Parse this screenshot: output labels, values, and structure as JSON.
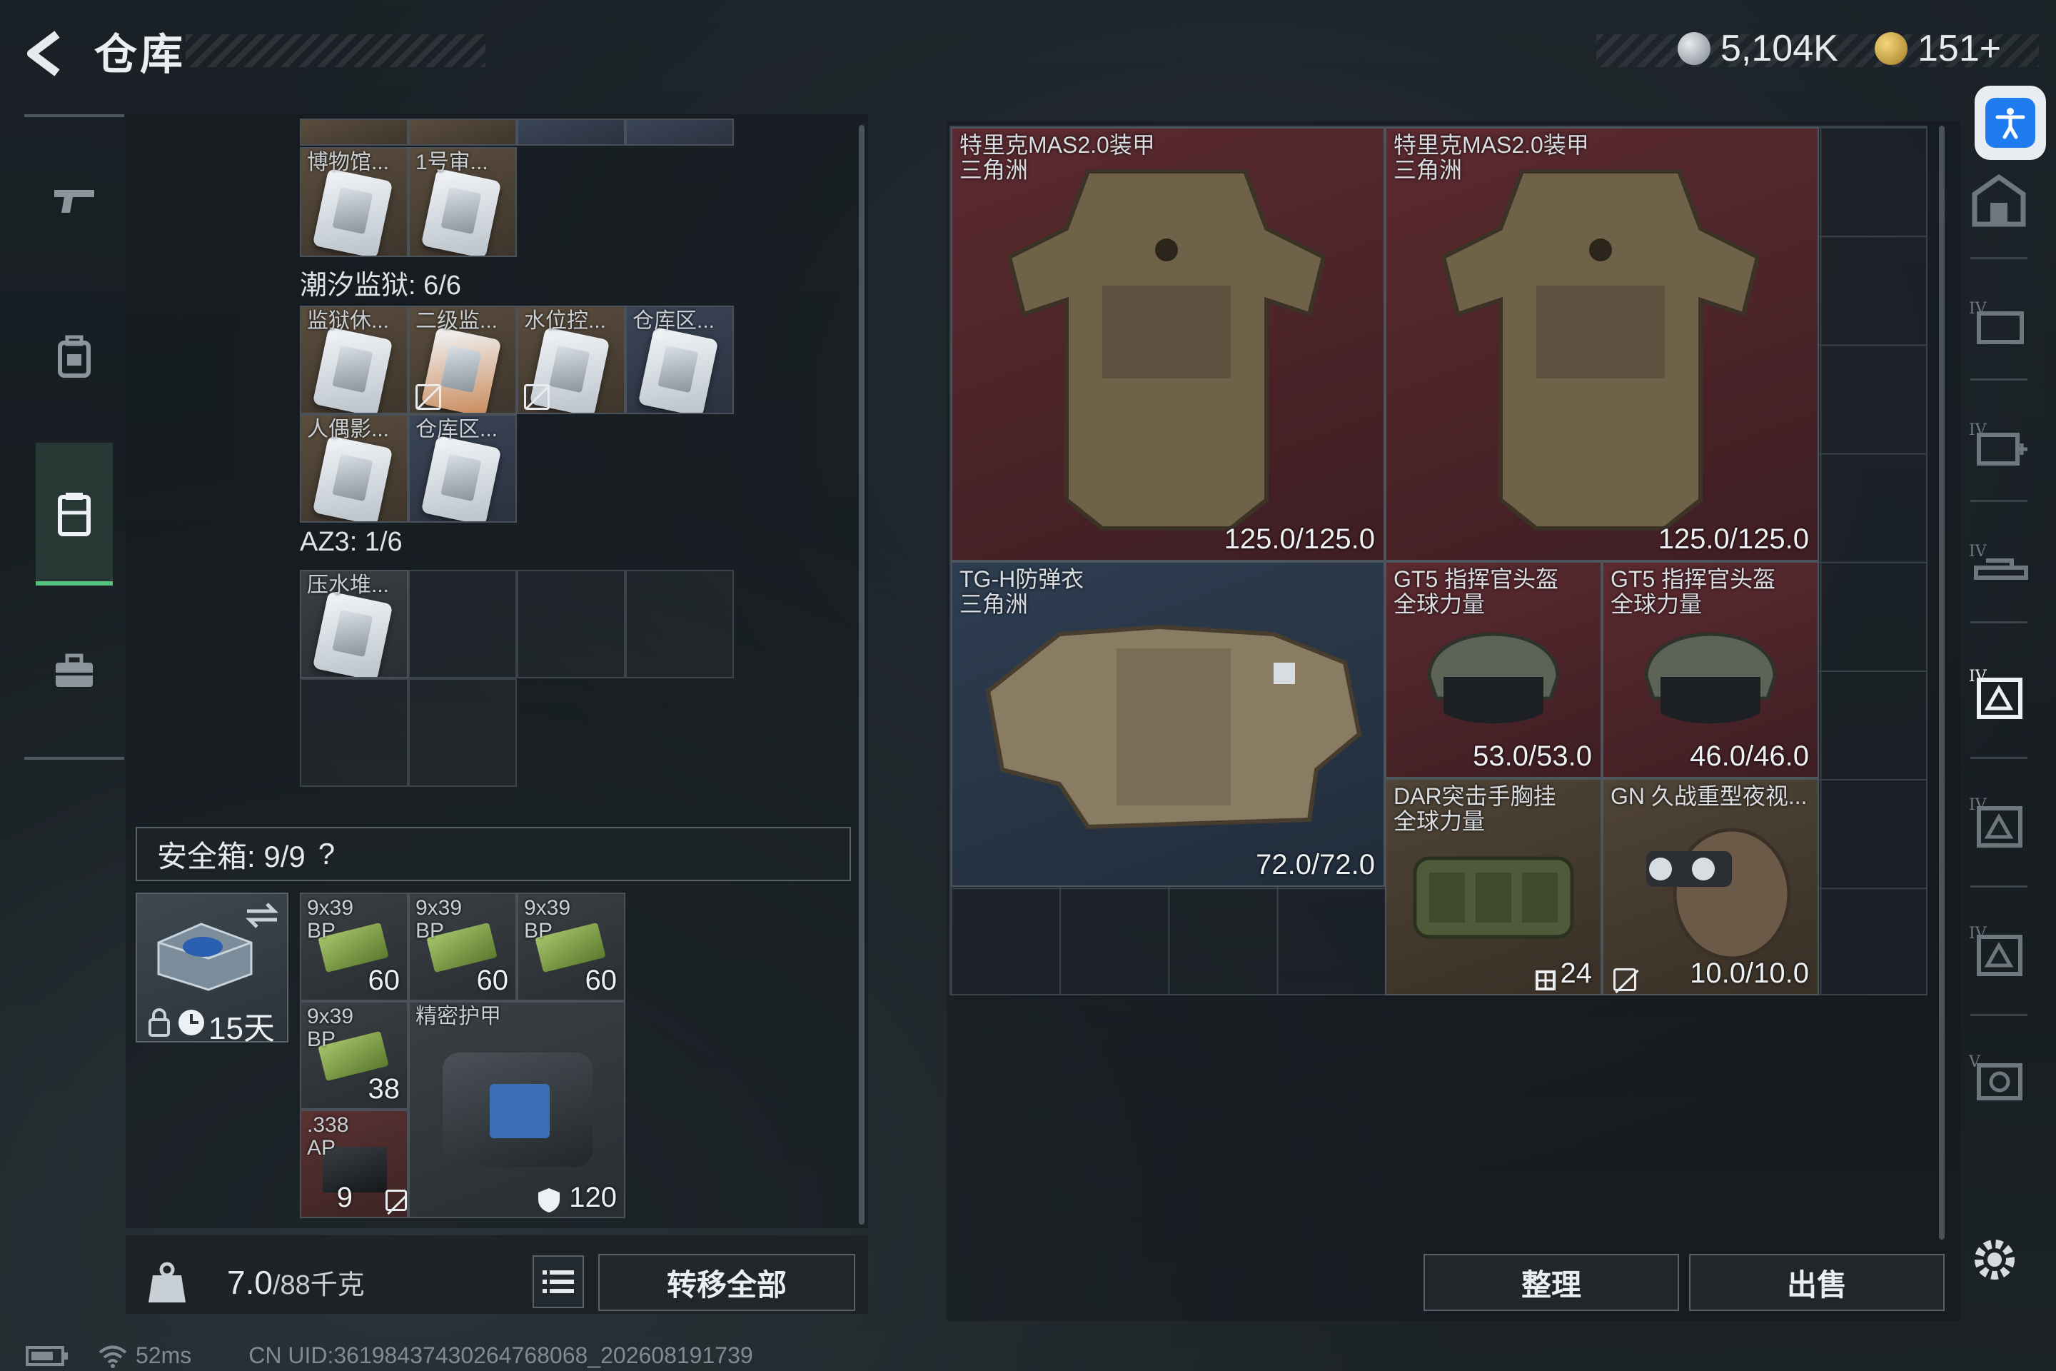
{
  "header": {
    "title": "仓库"
  },
  "currency": {
    "silver": "5,104K",
    "gold": "151+"
  },
  "left": {
    "top_partial_items": [
      {
        "label": "博物馆..."
      },
      {
        "label": "1号审..."
      }
    ],
    "sections": [
      {
        "name": "潮汐监狱: 6/6",
        "items": [
          {
            "label": "监狱休..."
          },
          {
            "label": "二级监..."
          },
          {
            "label": "水位控..."
          },
          {
            "label": "仓库区..."
          },
          {
            "label": "人偶影..."
          },
          {
            "label": "仓库区..."
          }
        ]
      },
      {
        "name": "AZ3: 1/6",
        "items": [
          {
            "label": "压水堆..."
          }
        ]
      }
    ],
    "safe": {
      "title": "安全箱: 9/9",
      "help": "?",
      "timer": "15天",
      "items": [
        {
          "label": "9x39\nBP",
          "count": "60"
        },
        {
          "label": "9x39\nBP",
          "count": "60"
        },
        {
          "label": "9x39\nBP",
          "count": "60"
        },
        {
          "label": "9x39\nBP",
          "count": "38"
        },
        {
          "label": "精密护甲",
          "count": "120"
        },
        {
          "label": ".338\nAP",
          "count": "9"
        }
      ]
    },
    "weight_value": "7.0",
    "weight_max": "/88千克",
    "transfer_all": "转移全部"
  },
  "right": {
    "items": [
      {
        "name": "特里克MAS2.0装甲",
        "sub": "三角洲",
        "durability": "125.0/125.0"
      },
      {
        "name": "特里克MAS2.0装甲",
        "sub": "三角洲",
        "durability": "125.0/125.0"
      },
      {
        "name": "TG-H防弹衣",
        "sub": "三角洲",
        "durability": "72.0/72.0"
      },
      {
        "name": "GT5 指挥官头盔",
        "sub": "全球力量",
        "durability": "53.0/53.0"
      },
      {
        "name": "GT5 指挥官头盔",
        "sub": "全球力量",
        "durability": "46.0/46.0"
      },
      {
        "name": "DAR突击手胸挂",
        "sub": "全球力量",
        "durability": "24"
      },
      {
        "name": "GN 久战重型夜视...",
        "sub": "",
        "durability": "10.0/10.0"
      }
    ],
    "sort_button": "整理",
    "sell_button": "出售"
  },
  "status": {
    "ping": "52ms",
    "uid": "CN UID:3619843743026476806​8_202608191739"
  },
  "colors": {
    "accent_green": "#55c27d",
    "accessibility_blue": "#1f7cf0",
    "rare_red": "#5b2a30",
    "rare_blue": "#2d3d50"
  }
}
